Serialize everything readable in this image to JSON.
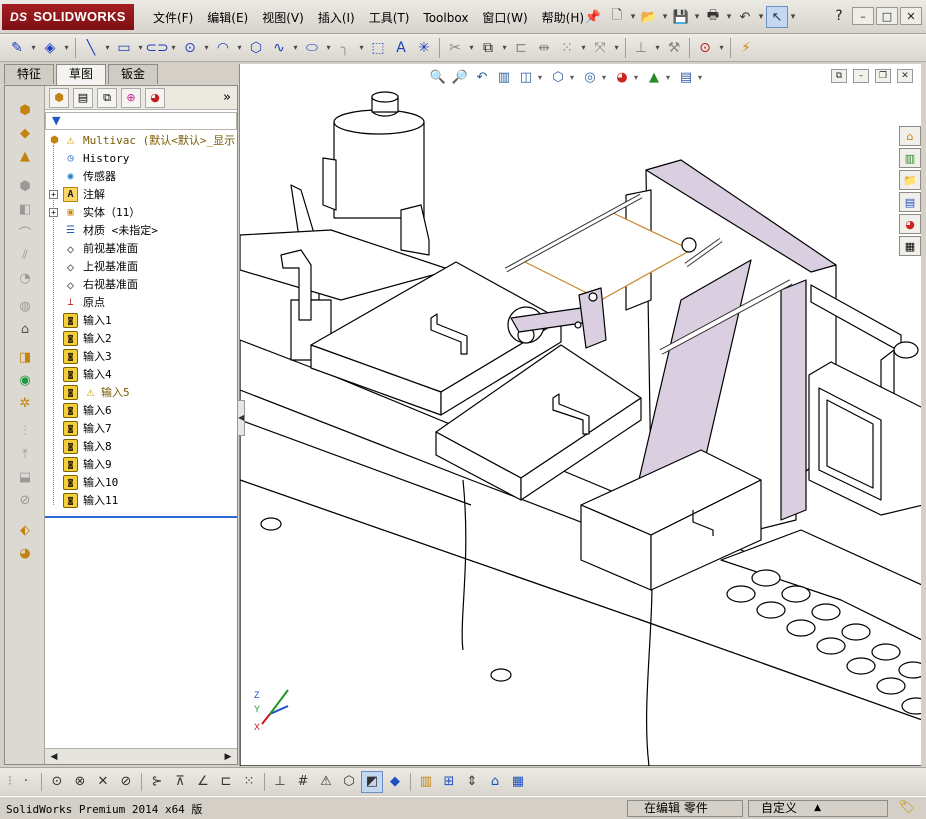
{
  "app": {
    "logo": "SOLIDWORKS",
    "logo_prefix": "DS",
    "menu": [
      "文件(F)",
      "编辑(E)",
      "视图(V)",
      "插入(I)",
      "工具(T)",
      "Toolbox",
      "窗口(W)",
      "帮助(H)"
    ],
    "window_controls": [
      "?",
      "–",
      "□",
      "✕"
    ]
  },
  "tabs": [
    "特征",
    "草图",
    "钣金"
  ],
  "active_tab": "草图",
  "filter_icon": "funnel-icon",
  "tree": [
    {
      "label": "Multivac  (默认<默认>_显示",
      "icon": "assembly-warning-icon",
      "depth": 0
    },
    {
      "label": "History",
      "icon": "history-icon",
      "depth": 1
    },
    {
      "label": "传感器",
      "icon": "sensor-icon",
      "depth": 1
    },
    {
      "label": "注解",
      "icon": "annotation-icon",
      "depth": 1,
      "expandable": true
    },
    {
      "label": "实体（11）",
      "icon": "solid-bodies-icon",
      "depth": 1,
      "expandable": true
    },
    {
      "label": "材质 <未指定>",
      "icon": "material-icon",
      "depth": 1
    },
    {
      "label": "前视基准面",
      "icon": "plane-icon",
      "depth": 1
    },
    {
      "label": "上视基准面",
      "icon": "plane-icon",
      "depth": 1
    },
    {
      "label": "右视基准面",
      "icon": "plane-icon",
      "depth": 1
    },
    {
      "label": "原点",
      "icon": "origin-icon",
      "depth": 1
    },
    {
      "label": "输入1",
      "icon": "imported-icon",
      "depth": 1
    },
    {
      "label": "输入2",
      "icon": "imported-icon",
      "depth": 1
    },
    {
      "label": "输入3",
      "icon": "imported-icon",
      "depth": 1
    },
    {
      "label": "输入4",
      "icon": "imported-icon",
      "depth": 1
    },
    {
      "label": "输入5",
      "icon": "imported-icon",
      "depth": 1,
      "warning": true
    },
    {
      "label": "输入6",
      "icon": "imported-icon",
      "depth": 1
    },
    {
      "label": "输入7",
      "icon": "imported-icon",
      "depth": 1
    },
    {
      "label": "输入8",
      "icon": "imported-icon",
      "depth": 1
    },
    {
      "label": "输入9",
      "icon": "imported-icon",
      "depth": 1
    },
    {
      "label": "输入10",
      "icon": "imported-icon",
      "depth": 1
    },
    {
      "label": "输入11",
      "icon": "imported-icon",
      "depth": 1
    }
  ],
  "status": {
    "product": "SolidWorks Premium 2014 x64 版",
    "mode": "在编辑 零件",
    "units": "自定义"
  },
  "colors": {
    "logo_red": "#a41f22",
    "selection_blue": "#2a6ad8",
    "model_face": "#ffffff",
    "model_dark": "#d9cfe0",
    "edge": "#000000",
    "highlight_edge": "#c8832a"
  }
}
